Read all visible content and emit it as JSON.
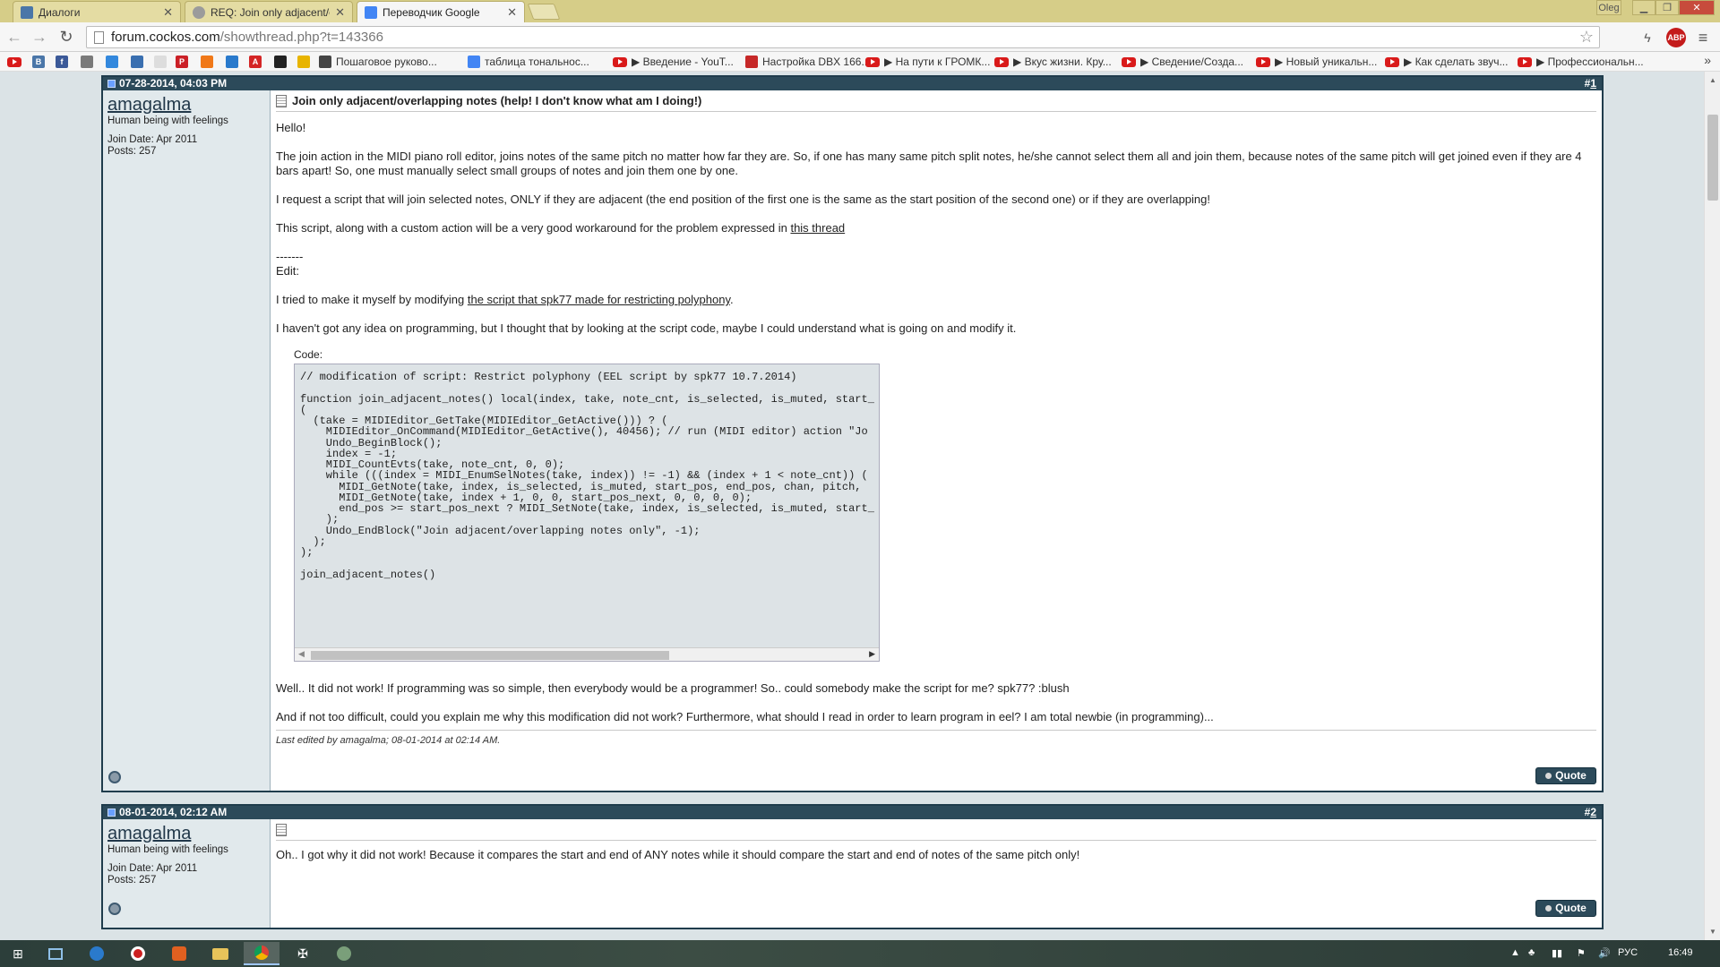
{
  "browser": {
    "tabs": [
      {
        "label": "Диалоги",
        "icon_color": "#4a76a8"
      },
      {
        "label": "REQ: Join only adjacent/o",
        "icon_color": "#9b9b9b"
      },
      {
        "label": "Переводчик Google",
        "icon_color": "#4285f4"
      }
    ],
    "window_controls": {
      "profile": "Oleg"
    },
    "url_host": "forum.cockos.com",
    "url_path": "/showthread.php?t=143366",
    "extensions": [
      "bookmark-star",
      "lightning",
      "ABP",
      "menu"
    ],
    "abp_label": "ABP"
  },
  "bookmarks": [
    {
      "label": "",
      "kind": "yt"
    },
    {
      "label": "B",
      "kind": "icon",
      "color": "#4a76a8"
    },
    {
      "label": "f",
      "kind": "icon",
      "color": "#3b5998"
    },
    {
      "label": "",
      "kind": "icon",
      "color": "#7a7a7a"
    },
    {
      "label": "",
      "kind": "icon",
      "color": "#3388dd"
    },
    {
      "label": "",
      "kind": "icon",
      "color": "#3a6fb0"
    },
    {
      "label": "",
      "kind": "icon",
      "color": "#dddddd"
    },
    {
      "label": "P",
      "kind": "icon",
      "color": "#cb2027"
    },
    {
      "label": "",
      "kind": "icon",
      "color": "#f07818"
    },
    {
      "label": "",
      "kind": "icon",
      "color": "#2a7acc"
    },
    {
      "label": "A",
      "kind": "icon",
      "color": "#d42525"
    },
    {
      "label": "",
      "kind": "icon",
      "color": "#222222"
    },
    {
      "label": "",
      "kind": "icon",
      "color": "#e8b400"
    },
    {
      "label": "Пошаговое руково...",
      "kind": "icon",
      "color": "#444444"
    },
    {
      "label": "таблица тональнос...",
      "kind": "icon",
      "color": "#4285f4"
    },
    {
      "label": "▶ Введение - YouT...",
      "kind": "yt"
    },
    {
      "label": "Настройка DBX 166...",
      "kind": "icon",
      "color": "#c62828"
    },
    {
      "label": "▶ На пути к ГРОМК...",
      "kind": "yt"
    },
    {
      "label": "▶ Вкус жизни. Кру...",
      "kind": "yt"
    },
    {
      "label": "▶ Сведение/Созда...",
      "kind": "yt"
    },
    {
      "label": "▶ Новый уникальн...",
      "kind": "yt"
    },
    {
      "label": "▶ Как сделать звуч...",
      "kind": "yt"
    },
    {
      "label": "▶ Профессиональн...",
      "kind": "yt"
    }
  ],
  "posts": [
    {
      "date": "07-28-2014, 04:03 PM",
      "num_prefix": "#",
      "num": "1",
      "user": {
        "name": "amagalma",
        "title": "Human being with feelings",
        "join": "Join Date: Apr 2011",
        "posts": "Posts: 257"
      },
      "title": "Join only adjacent/overlapping notes (help! I don't know what am I doing!)",
      "p1": "Hello!",
      "p2": "The join action in the MIDI piano roll editor, joins notes of the same pitch no matter how far they are. So, if one has many same pitch split notes, he/she cannot select them all and join them, because notes of the same pitch will get joined even if they are 4 bars apart! So, one must manually select small groups of notes and join them one by one.",
      "p3": "I request a script that will join selected notes, ONLY if they are adjacent (the end position of the first one is the same as the start position of the second one) or if they are overlapping!",
      "p4_pre": "This script, along with a custom action will be a very good workaround for the problem expressed in ",
      "p4_link": "this thread",
      "p5_line1": "-------",
      "p5_line2": "Edit:",
      "p6_pre": "I tried to make it myself by modifying ",
      "p6_link": "the script that spk77 made for restricting polyphony",
      "p6_post": ".",
      "p7": "I haven't got any idea on programming, but I thought that by looking at the script code, maybe I could understand what is going on and modify it.",
      "code_label": "Code:",
      "code": "// modification of script: Restrict polyphony (EEL script by spk77 10.7.2014)\n\nfunction join_adjacent_notes() local(index, take, note_cnt, is_selected, is_muted, start_\n(\n  (take = MIDIEditor_GetTake(MIDIEditor_GetActive())) ? (\n    MIDIEditor_OnCommand(MIDIEditor_GetActive(), 40456); // run (MIDI editor) action \"Jo\n    Undo_BeginBlock();\n    index = -1;\n    MIDI_CountEvts(take, note_cnt, 0, 0);\n    while (((index = MIDI_EnumSelNotes(take, index)) != -1) && (index + 1 < note_cnt)) (\n      MIDI_GetNote(take, index, is_selected, is_muted, start_pos, end_pos, chan, pitch, \n      MIDI_GetNote(take, index + 1, 0, 0, start_pos_next, 0, 0, 0, 0);\n      end_pos >= start_pos_next ? MIDI_SetNote(take, index, is_selected, is_muted, start_\n    );\n    Undo_EndBlock(\"Join adjacent/overlapping notes only\", -1);\n  );\n);\n\njoin_adjacent_notes()",
      "p8": "Well.. It did not work! If programming was so simple, then everybody would be a programmer! So.. could somebody make the script for me? spk77? :blush",
      "p9": "And if not too difficult, could you explain me why this modification did not work? Furthermore, what should I read in order to learn program in eel? I am total newbie (in programming)...",
      "edit_note": "Last edited by amagalma; 08-01-2014 at 02:14 AM.",
      "quote": "Quote"
    },
    {
      "date": "08-01-2014, 02:12 AM",
      "num_prefix": "#",
      "num": "2",
      "user": {
        "name": "amagalma",
        "title": "Human being with feelings",
        "join": "Join Date: Apr 2011",
        "posts": "Posts: 257"
      },
      "p1": "Oh.. I got why it did not work! Because it compares the start and end of ANY notes while it should compare the start and end of notes of the same pitch only!",
      "quote": "Quote"
    }
  ],
  "taskbar": {
    "apps": [
      "start",
      "explorer-window",
      "lightning-app",
      "opera",
      "tool-app",
      "file-explorer",
      "chrome",
      "horns-app",
      "cubase-app"
    ],
    "language": "РУС",
    "clock": "16:49"
  },
  "colors": {
    "header": "#2c4a5a",
    "page_bg": "#dbe3e6",
    "userinfo_bg": "#e1e9ec"
  }
}
